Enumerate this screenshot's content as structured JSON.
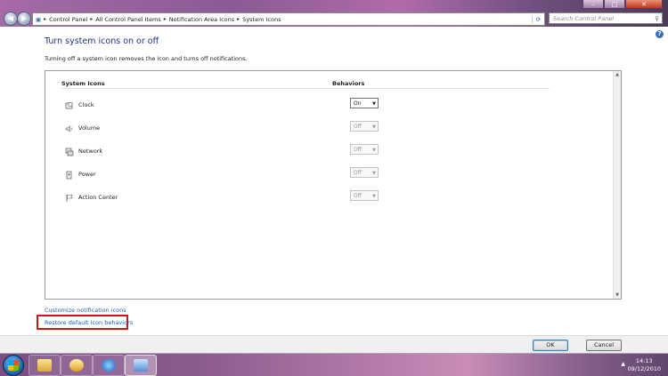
{
  "window": {
    "minimize_glyph": "–",
    "maximize_glyph": "□",
    "close_glyph": "✕"
  },
  "address": {
    "breadcrumbs": [
      "Control Panel",
      "All Control Panel Items",
      "Notification Area Icons",
      "System Icons"
    ],
    "separator": "▸",
    "search_placeholder": "Search Control Panel"
  },
  "page": {
    "title": "Turn system icons on or off",
    "intro": "Turning off a system icon removes the icon and turns off notifications."
  },
  "table": {
    "col_icons": "System Icons",
    "col_behaviors": "Behaviors",
    "rows": [
      {
        "label": "Clock",
        "value": "On",
        "enabled": true
      },
      {
        "label": "Volume",
        "value": "Off",
        "enabled": false
      },
      {
        "label": "Network",
        "value": "Off",
        "enabled": false
      },
      {
        "label": "Power",
        "value": "Off",
        "enabled": false
      },
      {
        "label": "Action Center",
        "value": "Off",
        "enabled": false
      }
    ]
  },
  "links": {
    "customize": "Customize notification icons",
    "restore": "Restore default icon behaviors"
  },
  "buttons": {
    "ok": "OK",
    "cancel": "Cancel"
  },
  "taskbar": {
    "time": "14:13",
    "date": "09/12/2010",
    "tray_arrow": "▲"
  }
}
